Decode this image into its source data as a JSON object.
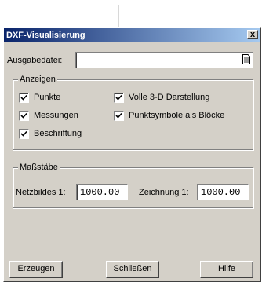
{
  "dialog": {
    "title": "DXF-Visualisierung",
    "close_label": "x"
  },
  "output": {
    "label": "Ausgabedatei:",
    "value": ""
  },
  "display_group": {
    "title": "Anzeigen",
    "items": [
      {
        "label": "Punkte",
        "checked": true
      },
      {
        "label": "Messungen",
        "checked": true
      },
      {
        "label": "Beschriftung",
        "checked": true
      },
      {
        "label": "Volle 3-D Darstellung",
        "checked": true
      },
      {
        "label": "Punktsymbole als Blöcke",
        "checked": true
      }
    ]
  },
  "scale_group": {
    "title": "Maßstäbe",
    "netzbildes_label": "Netzbildes 1:",
    "netzbildes_value": "1000.00",
    "zeichnung_label": "Zeichnung 1:",
    "zeichnung_value": "1000.00"
  },
  "buttons": {
    "generate": "Erzeugen",
    "close": "Schließen",
    "help": "Hilfe"
  }
}
